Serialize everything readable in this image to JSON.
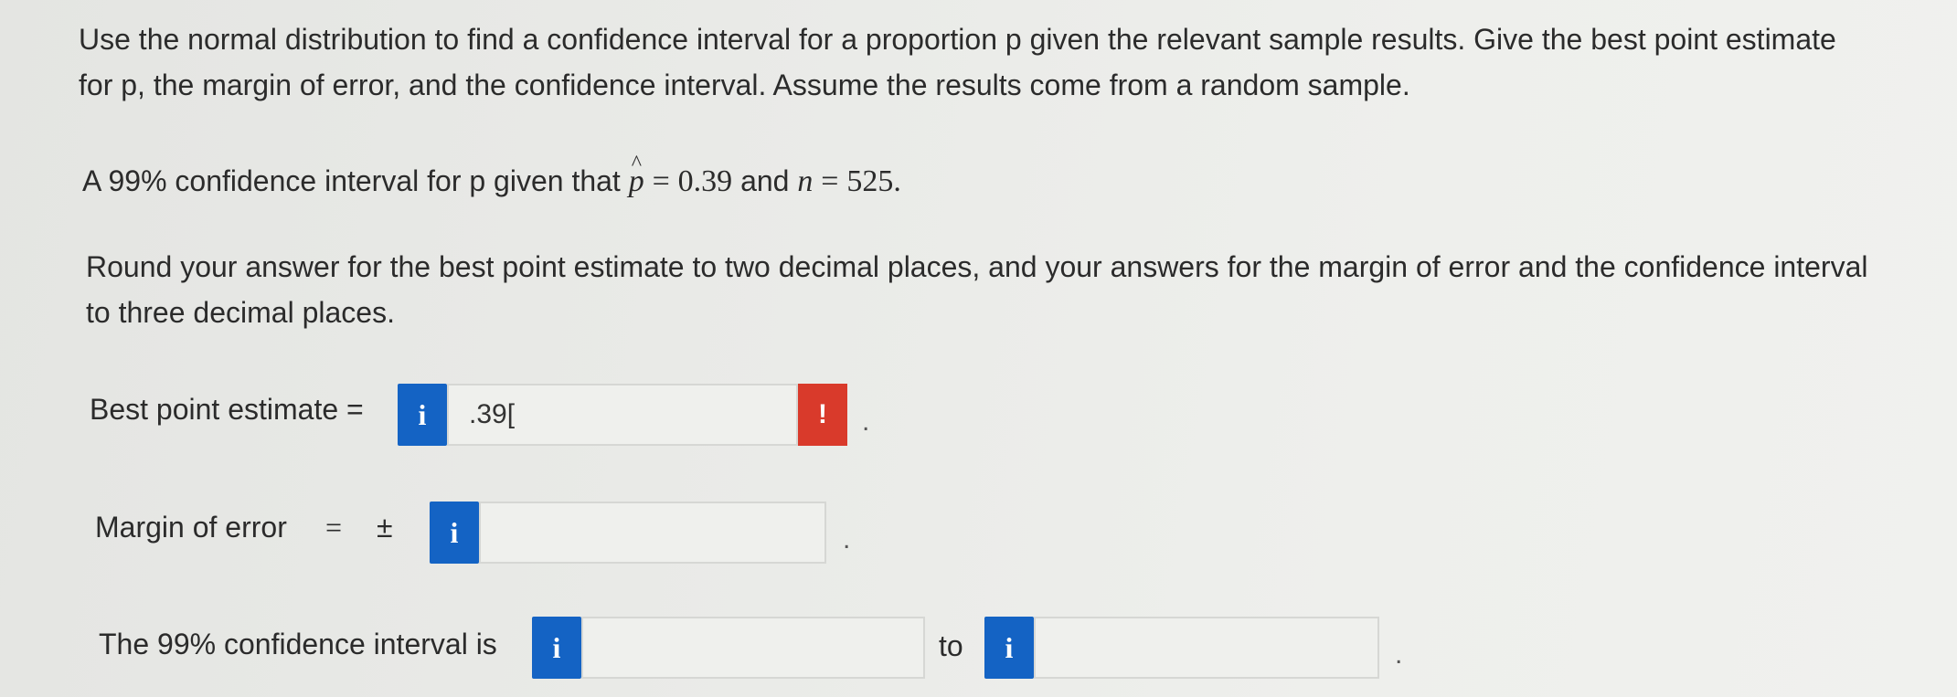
{
  "question": {
    "instructions": "Use the normal distribution to find a confidence interval for a proportion p given the relevant sample results. Give the best point estimate for p, the margin of error, and the confidence interval. Assume the results come from a random sample.",
    "given_prefix": "A 99% confidence interval for p given that",
    "p_hat_symbol": "p",
    "equals": "=",
    "p_hat_value": "0.39",
    "and_text": "and",
    "n_symbol": "n",
    "n_value": "525.",
    "rounding": "Round your answer for the best point estimate to two decimal places, and your answers for the margin of error and the confidence interval to three decimal places."
  },
  "best_point": {
    "label": "Best point estimate =",
    "info_icon": "i",
    "value": ".39[",
    "warning_icon": "!",
    "period": "."
  },
  "margin": {
    "label": "Margin of error",
    "equals": "=",
    "plus_minus": "±",
    "info_icon": "i",
    "value": "",
    "period": "."
  },
  "interval": {
    "label": "The 99% confidence interval is",
    "info_icon": "i",
    "lower_value": "",
    "to_text": "to",
    "upper_value": "",
    "period": "."
  },
  "colors": {
    "info_blue": "#1463c4",
    "warning_red": "#d93a2b"
  },
  "icons": {
    "info": "info-icon",
    "warning": "warning-icon"
  }
}
